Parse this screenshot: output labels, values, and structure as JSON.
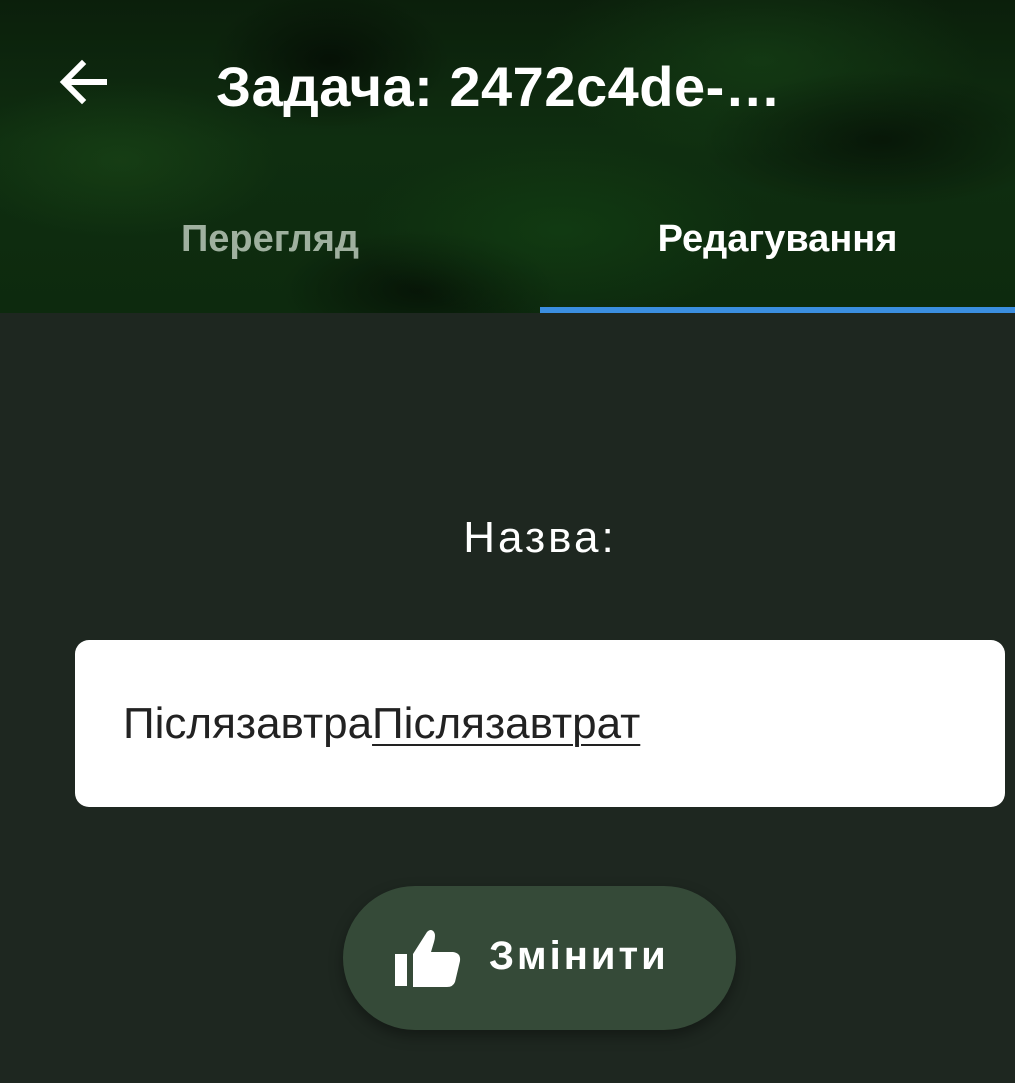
{
  "app_bar": {
    "title": "Задача: 2472c4de-…",
    "back_icon": "arrow-left-icon"
  },
  "tabs": [
    {
      "label": "Перегляд",
      "selected": false
    },
    {
      "label": "Редагування",
      "selected": true
    }
  ],
  "form": {
    "name_label": "Назва:",
    "name_value_committed": "Післязавтра",
    "name_value_composing": "Післязавтрат"
  },
  "submit_button": {
    "label": "Змінити",
    "icon": "thumbs-up-icon"
  },
  "colors": {
    "accent": "#3b8ee0",
    "background": "#1e2720",
    "button": "#354a38"
  }
}
